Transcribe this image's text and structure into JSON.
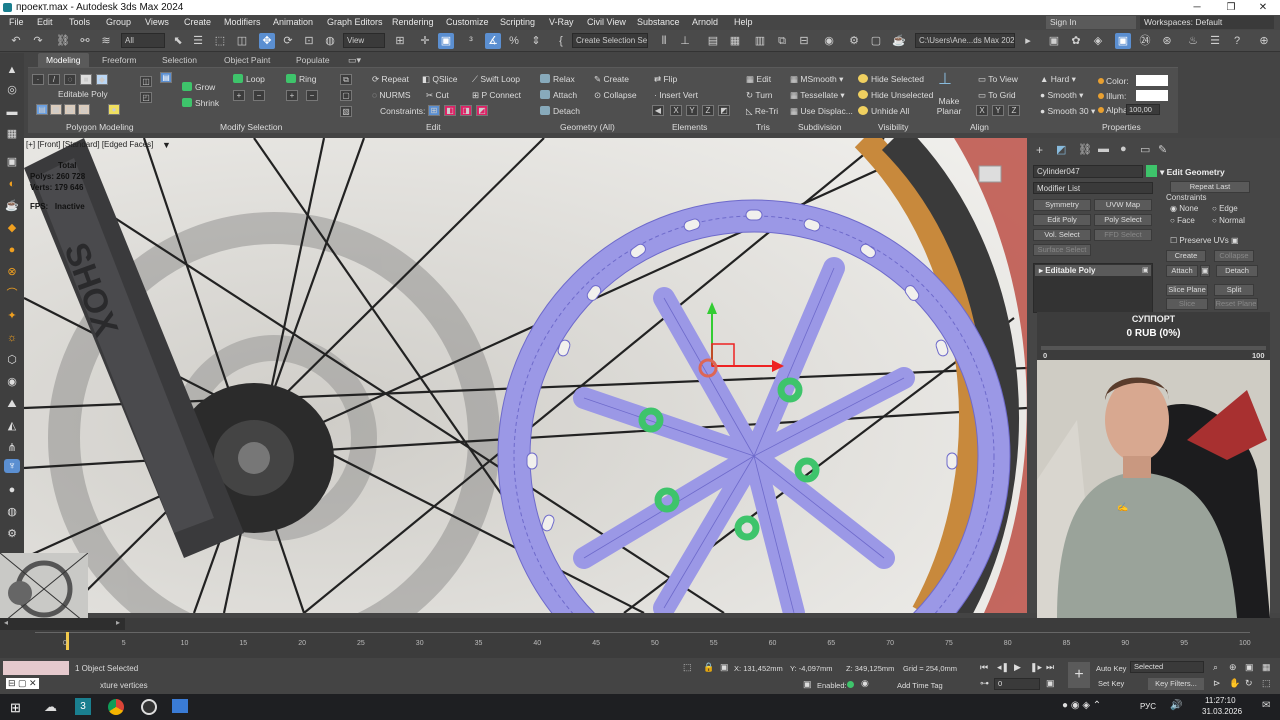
{
  "titlebar": {
    "title": "проект.max - Autodesk 3ds Max 2024"
  },
  "menu": [
    "File",
    "Edit",
    "Tools",
    "Group",
    "Views",
    "Create",
    "Modifiers",
    "Animation",
    "Graph Editors",
    "Rendering",
    "Customize",
    "Scripting",
    "V-Ray",
    "Civil View",
    "Substance",
    "Arnold",
    "Help"
  ],
  "menu_right": {
    "sign_in": "Sign In",
    "workspaces": "Workspaces: Default"
  },
  "toolbar": {
    "filter": "All",
    "ref_coord": "View",
    "selection_set": "Create Selection Se",
    "path": "C:\\Users\\Ane...ds Max 2024"
  },
  "ribbon": {
    "tabs": [
      "Modeling",
      "Freeform",
      "Selection",
      "Object Paint",
      "Populate"
    ],
    "active_tab": "Modeling",
    "editable_poly": "Editable Poly",
    "grow": "Grow",
    "shrink": "Shrink",
    "loop": "Loop",
    "ring": "Ring",
    "repeat": "Repeat",
    "qslice": "QSlice",
    "swift_loop": "Swift Loop",
    "nurms": "NURMS",
    "cut": "Cut",
    "p_connect": "P Connect",
    "constraints": "Constraints:",
    "relax": "Relax",
    "create": "Create",
    "attach": "Attach",
    "collapse": "Collapse",
    "detach": "Detach",
    "flip": "Flip",
    "insert_vert": "Insert Vert",
    "edit": "Edit",
    "turn": "Turn",
    "re_tri": "Re-Tri",
    "msmooth": "MSmooth",
    "tessellate": "Tessellate",
    "use_displac": "Use Displac...",
    "hide_selected": "Hide Selected",
    "hide_unselected": "Hide Unselected",
    "unhide_all": "Unhide All",
    "make_planar": "Make Planar",
    "to_view": "To View",
    "to_grid": "To Grid",
    "hard": "Hard",
    "smooth": "Smooth",
    "smooth30": "Smooth 30",
    "color": "Color:",
    "illum": "Illum:",
    "alpha": "Alpha:",
    "alpha_value": "100,00",
    "groups": {
      "polygon_modeling": "Polygon Modeling",
      "modify_selection": "Modify Selection",
      "edit": "Edit",
      "geometry": "Geometry (All)",
      "elements": "Elements",
      "tris": "Tris",
      "subdivision": "Subdivision",
      "visibility": "Visibility",
      "align": "Align",
      "properties": "Properties"
    }
  },
  "viewport": {
    "label": "[+] [Front] [Standard] [Edged Faces]",
    "stats": {
      "total": "Total",
      "polys_label": "Polys:",
      "polys": "260 728",
      "verts_label": "Verts:",
      "verts": "179 646",
      "fps_label": "FPS:",
      "fps": "Inactive"
    },
    "fork_text": "SHOX"
  },
  "command_panel": {
    "object_name": "Cylinder047",
    "modifier_list": "Modifier List",
    "buttons": [
      "Symmetry",
      "UVW Map",
      "Edit Poly",
      "Poly Select",
      "Vol. Select",
      "FFD Select",
      "Surface Select"
    ],
    "stack_item": "Editable Poly",
    "edit_geometry": "Edit Geometry",
    "repeat_last": "Repeat Last",
    "constraints": "Constraints",
    "none": "None",
    "edge": "Edge",
    "face": "Face",
    "normal": "Normal",
    "preserve_uvs": "Preserve UVs",
    "create": "Create",
    "collapse": "Collapse",
    "attach": "Attach",
    "detach": "Detach",
    "slice_plane": "Slice Plane",
    "split": "Split",
    "slice": "Slice",
    "reset_plane": "Reset Plane"
  },
  "support": {
    "title": "СУППОРТ",
    "amount": "0 RUB (0%)",
    "min": "0",
    "max": "100",
    "progress": 0
  },
  "timeline": {
    "frame": "0 / 100",
    "ticks": [
      "0",
      "5",
      "10",
      "15",
      "20",
      "25",
      "30",
      "35",
      "40",
      "45",
      "50",
      "55",
      "60",
      "65",
      "70",
      "75",
      "80",
      "85",
      "90",
      "95",
      "100"
    ]
  },
  "status": {
    "selected": "1 Object Selected",
    "prompt": "xture vertices",
    "x_label": "X:",
    "x": "131,452mm",
    "y_label": "Y:",
    "y": "-4,097mm",
    "z_label": "Z:",
    "z": "349,125mm",
    "grid": "Grid = 254,0mm",
    "enabled": "Enabled:",
    "add_time_tag": "Add Time Tag",
    "auto_key": "Auto Key",
    "key_mode": "Selected",
    "set_key": "Set Key",
    "key_filters": "Key Filters...",
    "frame": "0"
  },
  "taskbar": {
    "time": "11:27:10",
    "date": "31.03.2026",
    "lang": "РУС"
  },
  "colors": {
    "mesh": "#9b98e6",
    "mesh_line": "#6e6acb",
    "selection": "#3ec46b",
    "accent": "#5b8fd1",
    "rim": "#c8893c"
  }
}
